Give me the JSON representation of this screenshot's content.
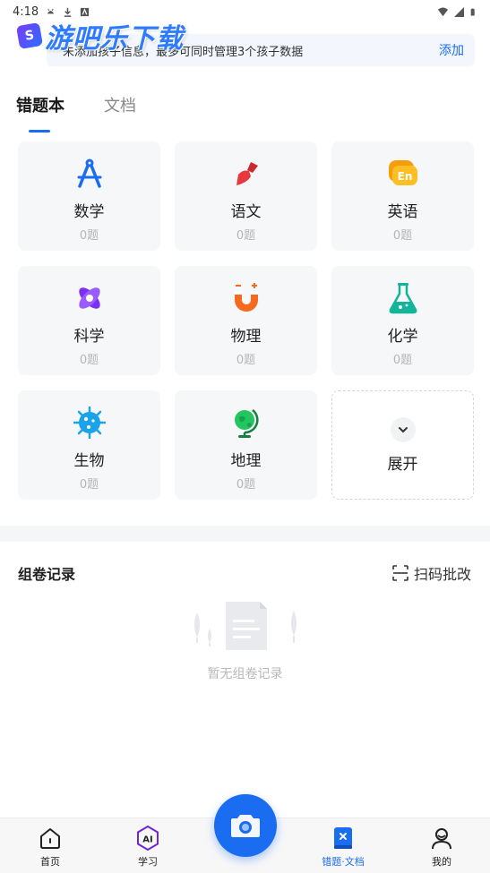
{
  "status_bar": {
    "time": "4:18"
  },
  "watermark": {
    "text": "游吧乐下载",
    "badge": "S"
  },
  "notice": {
    "message": "未添加孩子信息，最多可同时管理3个孩子数据",
    "add_label": "添加"
  },
  "tabs": [
    {
      "label": "错题本",
      "active": true
    },
    {
      "label": "文档",
      "active": false
    }
  ],
  "subjects": [
    {
      "name": "数学",
      "count": "0题",
      "icon": "compass-icon",
      "color": "#1a6cf0"
    },
    {
      "name": "语文",
      "count": "0题",
      "icon": "brush-icon",
      "color": "#e8383d"
    },
    {
      "name": "英语",
      "count": "0题",
      "icon": "en-chat-icon",
      "color": "#f5a623"
    },
    {
      "name": "科学",
      "count": "0题",
      "icon": "atom-icon",
      "color": "#7b2ff7"
    },
    {
      "name": "物理",
      "count": "0题",
      "icon": "magnet-icon",
      "color": "#f56a1f"
    },
    {
      "name": "化学",
      "count": "0题",
      "icon": "flask-icon",
      "color": "#13b59a"
    },
    {
      "name": "生物",
      "count": "0题",
      "icon": "microbe-icon",
      "color": "#1aa3e8"
    },
    {
      "name": "地理",
      "count": "0题",
      "icon": "globe-icon",
      "color": "#22c55e"
    }
  ],
  "expand": {
    "label": "展开",
    "icon": "chevron-down-icon"
  },
  "records": {
    "title": "组卷记录",
    "scan_label": "扫码批改",
    "empty_text": "暂无组卷记录"
  },
  "bottom_nav": [
    {
      "label": "首页",
      "icon": "home-icon",
      "active": false
    },
    {
      "label": "学习",
      "icon": "ai-icon",
      "active": false
    },
    {
      "label": "错题·文档",
      "icon": "wrongbook-icon",
      "active": true
    },
    {
      "label": "我的",
      "icon": "user-icon",
      "active": false
    }
  ],
  "colors": {
    "accent": "#1a6cf0",
    "card_bg": "#f6f7f9"
  }
}
